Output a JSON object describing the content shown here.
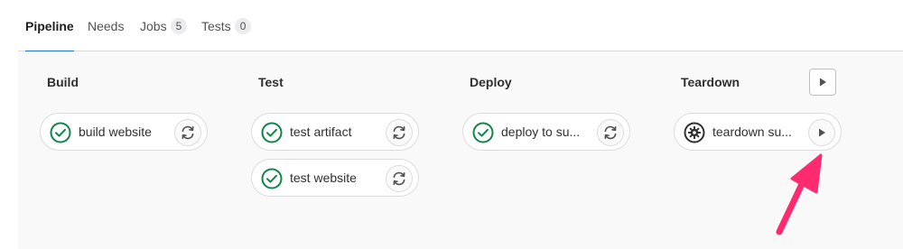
{
  "tabs": [
    {
      "label": "Pipeline",
      "active": true
    },
    {
      "label": "Needs"
    },
    {
      "label": "Jobs",
      "count": "5"
    },
    {
      "label": "Tests",
      "count": "0"
    }
  ],
  "stages": [
    {
      "title": "Build",
      "jobs": [
        {
          "name": "build website",
          "status": "success",
          "action": "retry"
        }
      ]
    },
    {
      "title": "Test",
      "jobs": [
        {
          "name": "test artifact",
          "status": "success",
          "action": "retry"
        },
        {
          "name": "test website",
          "status": "success",
          "action": "retry"
        }
      ]
    },
    {
      "title": "Deploy",
      "jobs": [
        {
          "name": "deploy to su...",
          "status": "success",
          "action": "retry"
        }
      ]
    },
    {
      "title": "Teardown",
      "jobs": [
        {
          "name": "teardown su...",
          "status": "manual",
          "action": "play"
        }
      ]
    }
  ],
  "colors": {
    "success": "#108548",
    "manual": "#303030",
    "annotation_arrow": "#ff2b70",
    "tab_underline": "#1f75cb"
  },
  "icons": {
    "success": "check-circle-icon",
    "manual": "gear-icon",
    "retry": "retry-icon",
    "play": "play-icon"
  }
}
